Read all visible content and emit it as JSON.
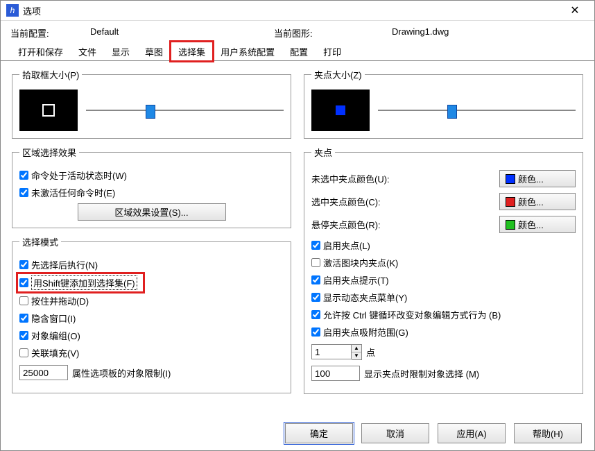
{
  "window": {
    "title": "选项"
  },
  "top": {
    "cur_profile_label": "当前配置:",
    "cur_profile_value": "Default",
    "cur_drawing_label": "当前图形:",
    "cur_drawing_value": "Drawing1.dwg"
  },
  "tabs": [
    "打开和保存",
    "文件",
    "显示",
    "草图",
    "选择集",
    "用户系统配置",
    "配置",
    "打印"
  ],
  "active_tab_index": 4,
  "highlight_tab_index": 4,
  "pickbox": {
    "legend": "拾取框大小(P)",
    "slider_pos_pct": 30
  },
  "gripsize": {
    "legend": "夹点大小(Z)",
    "slider_pos_pct": 35
  },
  "region_effect": {
    "legend": "区域选择效果",
    "cmd_active": {
      "label": "命令处于活动状态时(W)",
      "checked": true
    },
    "not_active": {
      "label": "未激活任何命令时(E)",
      "checked": true
    },
    "settings_btn": "区域效果设置(S)..."
  },
  "select_mode": {
    "legend": "选择模式",
    "items": [
      {
        "key": "noun_verb",
        "label": "先选择后执行(N)",
        "checked": true
      },
      {
        "key": "shift_add",
        "label": "用Shift键添加到选择集(F)",
        "checked": true,
        "highlight": true,
        "dotted": true
      },
      {
        "key": "press_drag",
        "label": "按住并拖动(D)",
        "checked": false
      },
      {
        "key": "implied_window",
        "label": "隐含窗口(I)",
        "checked": true
      },
      {
        "key": "object_group",
        "label": "对象编组(O)",
        "checked": true
      },
      {
        "key": "assoc_hatch",
        "label": "关联填充(V)",
        "checked": false
      }
    ],
    "limit_value": "25000",
    "limit_label": "属性选项板的对象限制(I)"
  },
  "grips": {
    "legend": "夹点",
    "unselected_color_label": "未选中夹点颜色(U):",
    "selected_color_label": "选中夹点颜色(C):",
    "hover_color_label": "悬停夹点颜色(R):",
    "color_btn": "颜色...",
    "unselected_swatch": "#0030ff",
    "selected_swatch": "#e02020",
    "hover_swatch": "#20c020",
    "items": [
      {
        "key": "enable_grips",
        "label": "启用夹点(L)",
        "checked": true
      },
      {
        "key": "grips_in_block",
        "label": "激活图块内夹点(K)",
        "checked": false
      },
      {
        "key": "grip_tips",
        "label": "启用夹点提示(T)",
        "checked": true
      },
      {
        "key": "dynamic_menu",
        "label": "显示动态夹点菜单(Y)",
        "checked": true
      },
      {
        "key": "ctrl_cycle",
        "label": "允许按 Ctrl 键循环改变对象编辑方式行为 (B)",
        "checked": true
      },
      {
        "key": "grip_snap",
        "label": "启用夹点吸附范围(G)",
        "checked": true
      }
    ],
    "point_value": "1",
    "point_label": "点",
    "limit_value": "100",
    "limit_label": "显示夹点时限制对象选择 (M)"
  },
  "footer": {
    "ok": "确定",
    "cancel": "取消",
    "apply": "应用(A)",
    "help": "帮助(H)"
  }
}
